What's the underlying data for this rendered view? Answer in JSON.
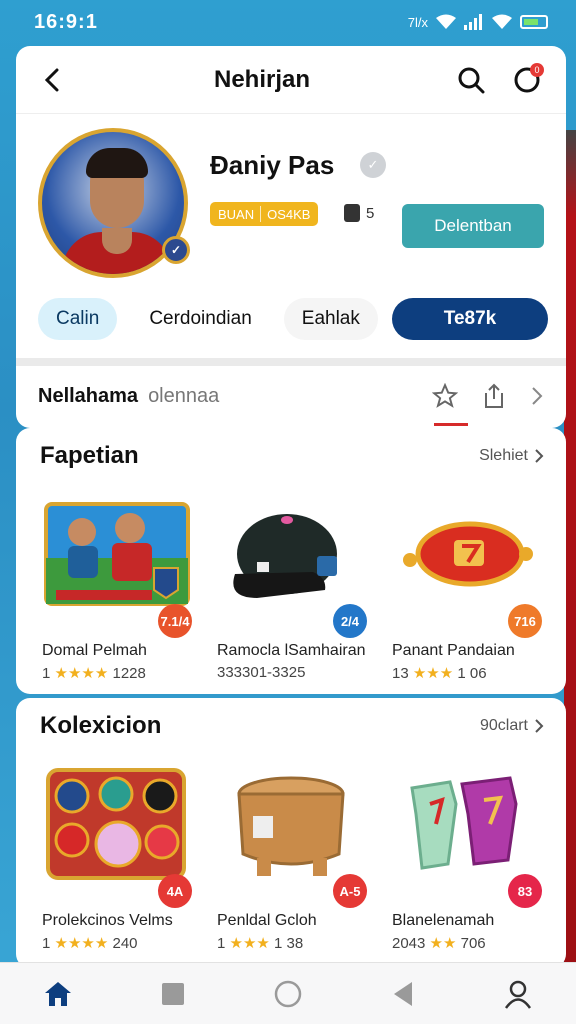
{
  "status_bar": {
    "time": "16:9:1",
    "network": "7l/x",
    "wifi_icon": "wifi-icon",
    "signal_icon": "signal-icon",
    "battery_icon": "battery-icon"
  },
  "header": {
    "back_icon": "back-arrow-icon",
    "title": "Nehirjan",
    "search_icon": "search-icon",
    "notifications_icon": "notifications-icon",
    "notification_count": "0"
  },
  "profile": {
    "name": "Đaniy Pas",
    "rank_left": "BUAN",
    "rank_right": "OS4KB",
    "level": "5",
    "follow_label": "Delentban"
  },
  "tabs": [
    {
      "label": "Calin"
    },
    {
      "label": "Cerdoindian"
    },
    {
      "label": "Eahlak"
    },
    {
      "label": "Te87k"
    }
  ],
  "subbar": {
    "title": "Nellahama",
    "subtitle": "olennaa",
    "star_icon": "star-icon",
    "share_icon": "share-icon",
    "chevron_icon": "chevron-right-icon"
  },
  "featured": {
    "title": "Fapetian",
    "see_all": "Slehiet",
    "items": [
      {
        "name": "Domal Pelmah",
        "rating_prefix": "1",
        "stars": "★★★★",
        "rating_suffix": "1228",
        "price": "7.1/4",
        "badge_color": "#e8532b"
      },
      {
        "name": "Ramocla lSamhairan",
        "rating_prefix": "",
        "stars": "",
        "rating_suffix": "333301-3325",
        "price": "2/4",
        "badge_color": "#2377c9"
      },
      {
        "name": "Panant Pandaian",
        "rating_prefix": "13",
        "stars": "★★★",
        "rating_suffix": "1 06",
        "price": "716",
        "badge_color": "#ef7a2a"
      }
    ]
  },
  "collection": {
    "title": "Kolexicion",
    "see_all": "90clart",
    "items": [
      {
        "name": "Prolekcinos Velms",
        "rating_prefix": "1",
        "stars": "★★★★",
        "rating_suffix": "240",
        "price": "4A",
        "badge_color": "#e53935"
      },
      {
        "name": "Penldal Gcloh",
        "rating_prefix": "1",
        "stars": "★★★",
        "rating_suffix": "1 38",
        "price": "A-5",
        "badge_color": "#e53935"
      },
      {
        "name": "Blanelenamah",
        "rating_prefix": "2043",
        "stars": "★★",
        "rating_suffix": "706",
        "price": "83",
        "badge_color": "#e5264a"
      }
    ]
  },
  "bottom_nav": [
    {
      "icon": "home-icon"
    },
    {
      "icon": "square-icon"
    },
    {
      "icon": "circle-icon"
    },
    {
      "icon": "back-triangle-icon"
    },
    {
      "icon": "profile-icon"
    }
  ],
  "colors": {
    "accent_blue": "#0d3e7f",
    "teal": "#3aa5ad",
    "gold": "#f0b51e",
    "red": "#d62a2a"
  }
}
